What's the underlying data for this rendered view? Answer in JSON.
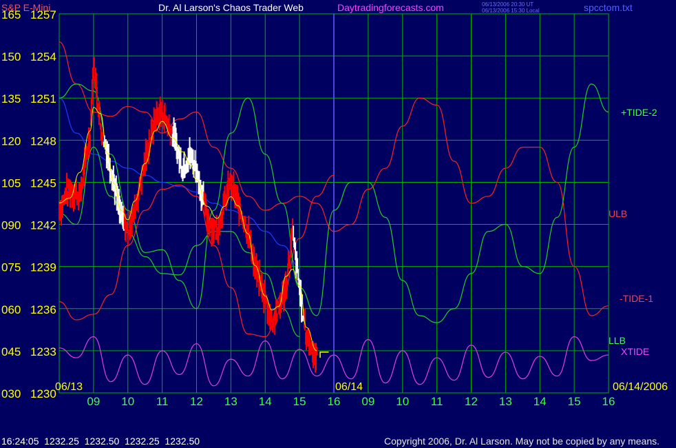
{
  "header": {
    "instrument": "S&P E-Mini",
    "title": "Dr. Al Larson's Chaos Trader Web",
    "website": "Daytradingforecasts.com",
    "timestamp_ut": "06/13/2006 20:30 UT",
    "timestamp_local": "06/13/2006 15:30 Local",
    "filename": "spcctom.txt"
  },
  "footer": {
    "quote": "16:24:05  1232.25  1232.50  1232.25  1232.50",
    "copyright": "Copyright 2006, Dr. Al Larson. May not be copied by any means."
  },
  "colors": {
    "background": "#000060",
    "grid": "#00b000",
    "price_bars": "#ff0000",
    "price_bars_alt": "#ffffff",
    "ulb_line": "#ff2020",
    "tide2_line": "#20d020",
    "xtide_line": "#e040e0",
    "blue_line": "#1a3cff",
    "yellow_line": "#f0f000",
    "separator": "#6060ff"
  },
  "chart_data": {
    "type": "line",
    "title": "Dr. Al Larson's Chaos Trader Web",
    "x_tick_labels": [
      "09",
      "10",
      "11",
      "12",
      "13",
      "14",
      "15",
      "16",
      "09",
      "10",
      "11",
      "12",
      "13",
      "14",
      "15",
      "16"
    ],
    "date_labels": [
      "06/13",
      "06/14",
      "06/14/2006"
    ],
    "y_ticks_price": [
      1257,
      1254,
      1251,
      1248,
      1245,
      1242,
      1239,
      1236,
      1233,
      1230
    ],
    "y_ticks_index": [
      "165",
      "150",
      "135",
      "120",
      "105",
      "090",
      "075",
      "060",
      "045",
      "030"
    ],
    "ylim": [
      1230,
      1257
    ],
    "grid": true,
    "series": [
      {
        "name": "S&P E-Mini",
        "type": "price",
        "x": [
          0,
          0.3,
          0.6,
          0.9,
          1.0,
          1.2,
          1.4,
          1.6,
          1.8,
          2.0,
          2.2,
          2.5,
          2.8,
          3.0,
          3.3,
          3.6,
          3.8,
          4.0,
          4.3,
          4.6,
          4.8,
          5.0,
          5.2,
          5.5,
          5.7,
          6.0,
          6.2,
          6.4,
          6.6,
          6.8,
          7.0,
          7.2,
          7.5
        ],
        "y": [
          1243,
          1244.6,
          1244,
          1248.5,
          1253.5,
          1249,
          1247.2,
          1245,
          1242.5,
          1241.5,
          1243,
          1246.5,
          1249.5,
          1250,
          1248.5,
          1246,
          1247,
          1246,
          1242.5,
          1241.4,
          1243.4,
          1245,
          1243.5,
          1241.5,
          1239,
          1236.7,
          1235,
          1236,
          1237.5,
          1241.4,
          1237.5,
          1234,
          1232.5
        ]
      },
      {
        "name": "ULB",
        "x": [
          0,
          0.5,
          1.0,
          1.5,
          2.0,
          2.5,
          3.0,
          3.5,
          4.0,
          4.5,
          5.0,
          5.5,
          6.0,
          6.5,
          7.0,
          7.5,
          8.0,
          8.5,
          9.0,
          9.5,
          10.0,
          10.5,
          11.0,
          11.5,
          12.0,
          12.5,
          13.0,
          13.5,
          14.0,
          14.5,
          15.0,
          15.5,
          16.0
        ],
        "y": [
          1255,
          1252,
          1250,
          1249.7,
          1250.4,
          1250,
          1248.5,
          1249.5,
          1250,
          1247.5,
          1246,
          1244,
          1243,
          1243.5,
          1244,
          1243.5,
          1241.5,
          1242,
          1244.5,
          1246,
          1249,
          1251,
          1250.5,
          1246.5,
          1243.5,
          1244,
          1246,
          1247.5,
          1247.5,
          1245,
          1239,
          1235.5,
          1236.2
        ]
      },
      {
        "name": "-TIDE-1",
        "x": [
          0,
          0.5,
          1.0,
          1.5,
          2.0,
          2.5,
          3.0,
          3.5,
          4.0,
          4.5,
          5.0,
          5.5,
          6.0,
          6.5,
          7.0,
          7.5,
          8.0
        ],
        "y": [
          1236.5,
          1235.2,
          1235.6,
          1237,
          1240.5,
          1243,
          1244.5,
          1244.8,
          1244,
          1240.5,
          1237.5,
          1234.2,
          1234,
          1237,
          1241,
          1244,
          1245.5
        ]
      },
      {
        "name": "+TIDE-2",
        "x": [
          0,
          0.5,
          1.0,
          1.5,
          2.0,
          2.5,
          3.0,
          3.5,
          4.0,
          4.5,
          5.0,
          5.5,
          6.0,
          6.5,
          7.0,
          7.5,
          8.0,
          8.5,
          9.0,
          9.5,
          10.0,
          10.5,
          11.0,
          11.5,
          12.0,
          12.5,
          13.0,
          13.5,
          14.0,
          14.5,
          15.0,
          15.5,
          16.0
        ],
        "y": [
          1251,
          1252,
          1251.5,
          1247,
          1243,
          1240,
          1240.2,
          1238,
          1236,
          1243,
          1248.5,
          1251,
          1247,
          1243.5,
          1237.5,
          1235.5,
          1243,
          1245,
          1245,
          1242.5,
          1238,
          1235.5,
          1235,
          1236,
          1238.5,
          1241.5,
          1242,
          1239,
          1238.5,
          1242.5,
          1247.5,
          1252,
          1250
        ]
      },
      {
        "name": "LLB",
        "x": [
          0,
          0.5,
          1.0,
          1.5,
          2.0,
          2.5,
          3.0,
          3.5,
          4.0,
          4.5,
          5.0,
          5.5,
          6.0,
          6.5,
          7.0
        ],
        "y": [
          1242.8,
          1242,
          1247.5,
          1244,
          1241.4,
          1239.7,
          1238.5,
          1238.4,
          1240.5,
          1241.5,
          1241.5,
          1240,
          1238.5,
          1236,
          1234
        ]
      },
      {
        "name": "XTIDE",
        "type": "oscillator",
        "x": [
          0,
          0.5,
          1.0,
          1.5,
          2.0,
          2.5,
          3.0,
          3.5,
          4.0,
          4.5,
          5.0,
          5.5,
          6.0,
          6.5,
          7.0,
          7.5,
          8.0,
          8.5,
          9.0,
          9.5,
          10.0,
          10.5,
          11.0,
          11.5,
          12.0,
          12.5,
          13.0,
          13.5,
          14.0,
          14.5,
          15.0,
          15.5,
          16.0
        ],
        "y": [
          1233.2,
          1232.5,
          1234.0,
          1230.8,
          1232.7,
          1230.6,
          1233.0,
          1231.3,
          1233.5,
          1230.5,
          1232.4,
          1231.2,
          1233.7,
          1231.0,
          1233.1,
          1231.2,
          1232.7,
          1231.0,
          1233.8,
          1230.7,
          1233.0,
          1230.6,
          1232.5,
          1230.9,
          1233.4,
          1231.1,
          1232.9,
          1231.0,
          1232.6,
          1231.2,
          1234.0,
          1232.3,
          1232.7
        ]
      },
      {
        "name": "",
        "type": "trend",
        "x": [
          0,
          0.5,
          1.0,
          1.5,
          2.0,
          2.5,
          3.0,
          3.5,
          4.0,
          4.5,
          5.0,
          5.5,
          6.0,
          6.5,
          7.0
        ],
        "y": [
          1251,
          1248.5,
          1247,
          1246.5,
          1246,
          1245.5,
          1245,
          1244.7,
          1244.3,
          1243.5,
          1243,
          1242.5,
          1241.5,
          1240.5,
          1239
        ]
      }
    ],
    "legend_labels": [
      "+TIDE-2",
      "ULB",
      "-TIDE-1",
      "LLB",
      "XTIDE"
    ],
    "price_markers": [
      1257,
      1254,
      1251,
      1248,
      1245,
      1242,
      1239,
      1236,
      1233,
      1230
    ]
  }
}
